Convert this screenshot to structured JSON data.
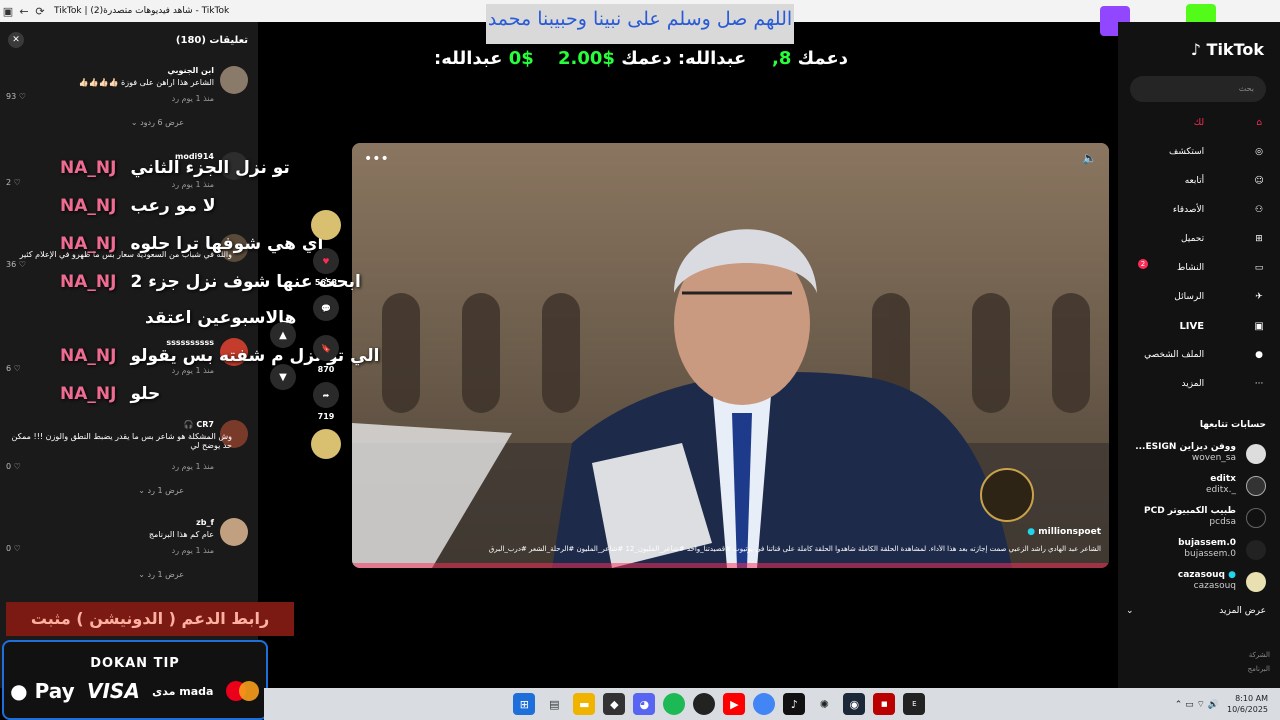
{
  "browser": {
    "title": "TikTok | شاهد فيديوهات متصدرة(2) - TikTok",
    "back": "←",
    "reload": "⟳"
  },
  "comments": {
    "title": "تعليقات (180)",
    "close": "✕",
    "items": [
      {
        "name": "ابن الجنوبي",
        "text": "الشاعر هذا اراهن على فوزة 👍🏻👍🏻👍🏻👍🏻",
        "meta": "منذ 1 يوم    رد",
        "likes": "93",
        "replies": "عرض 6 ردود ⌄"
      },
      {
        "name": "modi914",
        "text": "",
        "meta": "منذ 1 يوم    رد",
        "likes": "2",
        "replies": ""
      },
      {
        "name": "",
        "text": "والله في شباب من السعودية سعار بس ما ظهرو في الإعلام كثير",
        "meta": "",
        "likes": "36",
        "replies": ""
      },
      {
        "name": "ssssssssss",
        "text": "",
        "meta": "منذ 1 يوم    رد",
        "likes": "6",
        "replies": ""
      },
      {
        "name": "CR7 🎧",
        "text": "وش المشكلة هو شاعر بس ما يقدر يضبط النطق والوزن !!! ممكن حد يوضح لي",
        "meta": "منذ 1 يوم    رد",
        "likes": "0",
        "replies": "عرض 1 رد ⌄"
      },
      {
        "name": "zb_f",
        "text": "عام كم هذا البرنامج",
        "meta": "منذ 1 يوم    رد",
        "likes": "0",
        "replies": "عرض 1 رد ⌄"
      }
    ]
  },
  "overlay": {
    "dua": "اللهم صل وسلم على نبينا وحبيبنا محمد",
    "counters": [
      {
        "label": "عبدالله:",
        "value": "0$"
      },
      {
        "label": "عبدالله: دعمك",
        "value": "$2.00"
      },
      {
        "label": "دعمك",
        "value": "8,"
      }
    ],
    "chat": [
      {
        "user": "NA_NJ",
        "msg": "تو نزل الجزء الثاني"
      },
      {
        "user": "NA_NJ",
        "msg": "لا مو رعب"
      },
      {
        "user": "NA_NJ",
        "msg": "اي هي شوفها ترا حلوه"
      },
      {
        "user": "NA_NJ",
        "msg": "ابحث عنها شوف نزل جزء 2"
      },
      {
        "user": "",
        "msg": "هالاسبوعين اعتقد"
      },
      {
        "user": "NA_NJ",
        "msg": "الي تو نزل م شفته بس يقولو"
      },
      {
        "user": "NA_NJ",
        "msg": "حلو"
      }
    ],
    "support_text": "رابط الدعم ( الدونيشن ) مثبت بالشات",
    "dokan": {
      "title": "DOKAN TIP",
      "apple": " Pay",
      "visa": "VISA",
      "mada": "مدى mada"
    }
  },
  "video": {
    "caption_user": "millionspoet",
    "caption": "الشاعر عبد الهادي راشد الزعبي صمت إجازته بعد هذا الأداء. لمشاهدة الحلقة الكاملة شاهدوا الحلقة كاملة على قناتنا في يوتيوب #قصيدتنا_واحد #شاعر_المليون_12 #شاعر_المليون #الرحلة_الشعر #درب_البرق"
  },
  "actions": {
    "likes": "5658",
    "bookmarks": "870",
    "shares": "719"
  },
  "sidebar": {
    "logo": "TikTok",
    "search_placeholder": "بحث",
    "menu": [
      {
        "label": "لك",
        "icon": "home-icon"
      },
      {
        "label": "استكشف",
        "icon": "compass-icon"
      },
      {
        "label": "أتابعه",
        "icon": "following-icon"
      },
      {
        "label": "الأصدقاء",
        "icon": "friends-icon"
      },
      {
        "label": "تحميل",
        "icon": "upload-icon"
      },
      {
        "label": "النشاط",
        "icon": "activity-icon",
        "badge": "2"
      },
      {
        "label": "الرسائل",
        "icon": "messages-icon"
      },
      {
        "label": "LIVE",
        "icon": "live-icon"
      },
      {
        "label": "الملف الشخصي",
        "icon": "profile-icon"
      },
      {
        "label": "المزيد",
        "icon": "more-icon"
      }
    ],
    "following_title": "حسابات تتابعها",
    "following": [
      {
        "name": "ووفن ديزاين ESIGN...",
        "user": "woven_sa"
      },
      {
        "name": "editx",
        "user": "_.editx"
      },
      {
        "name": "طبيب الكمبيوتر PCD",
        "user": "pcdsa"
      },
      {
        "name": "bujassem.0",
        "user": "bujassem.0"
      },
      {
        "name": "cazasouq",
        "user": "cazasouq"
      }
    ],
    "see_more": "عرض المزيد",
    "footer": [
      "الشركة",
      "البرنامج"
    ]
  },
  "taskbar": {
    "time": "8:10 AM",
    "date": "10/6/2025"
  },
  "colors": {
    "accent": "#fe2c55",
    "chat_user": "#f06b92",
    "counter_green": "#28ff3c",
    "dua_blue": "#2a5bd7"
  }
}
